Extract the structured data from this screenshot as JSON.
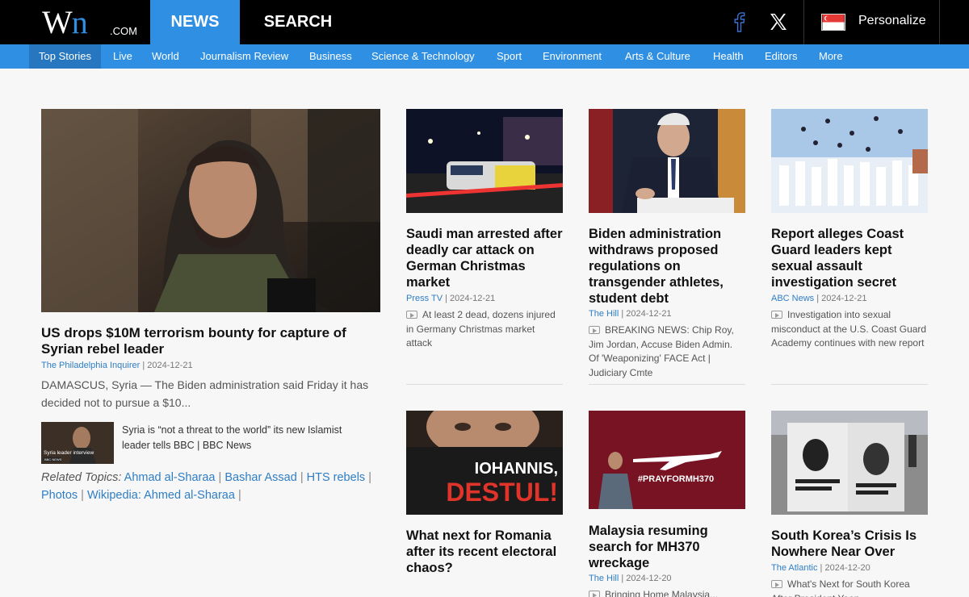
{
  "header": {
    "logo_main": "W",
    "logo_n": "n",
    "logo_com": ".COM",
    "nav_news": "NEWS",
    "nav_search": "SEARCH",
    "personalize": "Personalize"
  },
  "subnav": [
    "Top Stories",
    "Live",
    "World",
    "Journalism Review",
    "Business",
    "Science & Technology",
    "Sport",
    "Environment",
    "Arts & Culture",
    "Health",
    "Editors",
    "More"
  ],
  "lead": {
    "title": "US drops $10M terrorism bounty for capture of Syrian rebel leader",
    "source": "The Philadelphia Inquirer",
    "date": "2024-12-21",
    "desc": "DAMASCUS, Syria — The Biden administration said Friday it has decided not to pursue a $10...",
    "related_thumb_caption": "Syria leader interview",
    "related_thumb_badge": "BBC NEWS",
    "related_text": "Syria is “not a threat to the world” its new Islamist leader tells BBC | BBC News",
    "topics_label": "Related Topics:",
    "topics": [
      "Ahmad al-Sharaa",
      "Bashar Assad",
      "HTS rebels",
      "Photos",
      "Wikipedia: Ahmed al-Sharaa"
    ]
  },
  "cards": [
    {
      "title": "Saudi man arrested after deadly car attack on German Christmas market",
      "source": "Press TV",
      "date": "2024-12-21",
      "desc": "At least 2 dead, dozens injured in Germany Christmas market attack"
    },
    {
      "title": "Biden administration withdraws proposed regulations on transgender athletes, student debt",
      "source": "The Hill",
      "date": "2024-12-21",
      "desc": "BREAKING NEWS: Chip Roy, Jim Jordan, Accuse Biden Admin. Of 'Weaponizing' FACE Act | Judiciary Cmte"
    },
    {
      "title": "Report alleges Coast Guard leaders kept sexual assault investigation secret",
      "source": "ABC News",
      "date": "2024-12-21",
      "desc": "Investigation into sexual misconduct at the U.S. Coast Guard Academy continues with new report"
    },
    {
      "title": "What next for Romania after its recent electoral chaos?",
      "image_text_1": "IOHANNIS,",
      "image_text_2": "DESTUL!"
    },
    {
      "title": "Malaysia resuming search for MH370 wreckage",
      "source": "The Hill",
      "date": "2024-12-20",
      "desc": "Bringing Home Malaysia...",
      "image_text": "#PRAYFORMH370"
    },
    {
      "title": "South Korea’s Crisis Is Nowhere Near Over",
      "source": "The Atlantic",
      "date": "2024-12-20",
      "desc": "What's Next for South Korea After President Yoon..."
    }
  ],
  "colors": {
    "accent": "#2f8fe3",
    "header_bg": "#000000",
    "link": "#2f7ec5"
  }
}
